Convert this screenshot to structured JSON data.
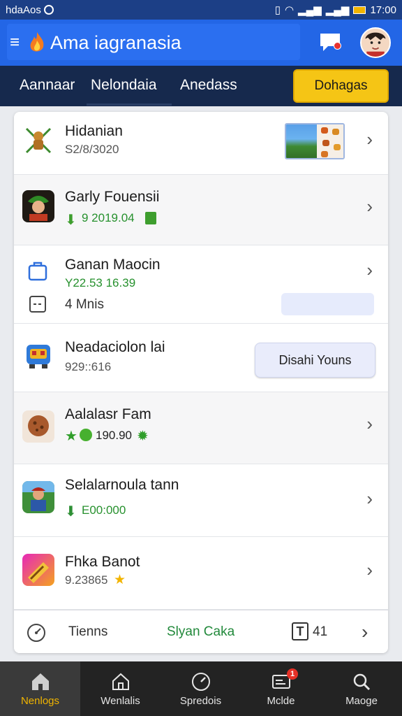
{
  "status_bar": {
    "left_text": "hdaAos",
    "time": "17:00"
  },
  "app_bar": {
    "title": "Ama iagranasia"
  },
  "tabs": {
    "items": [
      "Aannaar",
      "Nelondaia",
      "Anedass"
    ],
    "cta": "Dohagas"
  },
  "list": {
    "rows": [
      {
        "title": "Hidanian",
        "subtitle": "S2/8/3020",
        "icon": "crossed-figure-icon"
      },
      {
        "title": "Garly Fouensii",
        "subtitle": "9 2019.04",
        "icon": "warrior-avatar-icon"
      },
      {
        "title": "Ganan Maocin",
        "subtitle": "Y22.53 16.39",
        "icon": "bag-icon",
        "detail": "4 Mnis",
        "detail_icon": "box-icon"
      },
      {
        "title": "Neadaciolon lai",
        "subtitle": "929::616",
        "icon": "robot-game-icon",
        "button": "Disahi Youns"
      },
      {
        "title": "Aalalasr Fam",
        "subtitle": "190.90",
        "icon": "cookie-icon"
      },
      {
        "title": "Selalarnoula tann",
        "subtitle": "E00:000",
        "icon": "adventurer-icon"
      },
      {
        "title": "Fhka Banot",
        "subtitle": "9.23865",
        "icon": "gradient-app-icon"
      }
    ],
    "footer": {
      "label": "Tienns",
      "middle": "Slyan Caka",
      "count": "41"
    }
  },
  "bottom_nav": {
    "items": [
      "Nenlogs",
      "Wenlalis",
      "Spredois",
      "Mclde",
      "Maoge"
    ],
    "active_index": 0,
    "badge": "1"
  },
  "colors": {
    "brand_blue": "#2366e6",
    "nav_dark": "#16294d",
    "accent_yellow": "#f5c515",
    "green": "#27912e"
  }
}
